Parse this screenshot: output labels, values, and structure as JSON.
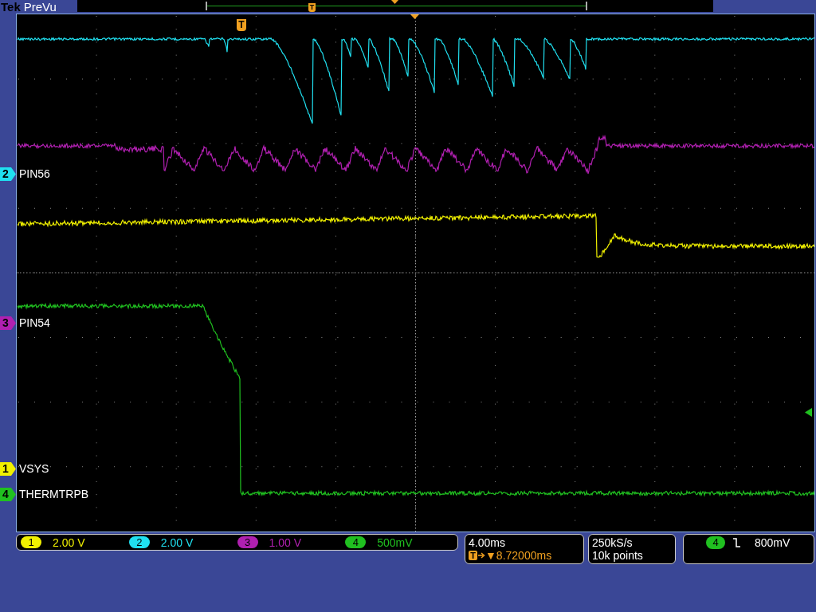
{
  "header": {
    "brand": "Tek",
    "mode": "PreVu",
    "record_marker": "T"
  },
  "graticule": {
    "trigger_marker": "T"
  },
  "channel_labels": [
    {
      "number": "2",
      "label": "PIN56",
      "color": "#20e0f0"
    },
    {
      "number": "3",
      "label": "PIN54",
      "color": "#b020b0"
    },
    {
      "number": "1",
      "label": "VSYS",
      "color": "#f0f000"
    },
    {
      "number": "4",
      "label": "THERMTRPB",
      "color": "#20c020"
    }
  ],
  "channel_scales": [
    {
      "number": "1",
      "scale": "2.00 V",
      "color": "#f0f000"
    },
    {
      "number": "2",
      "scale": "2.00 V",
      "color": "#20e0f0"
    },
    {
      "number": "3",
      "scale": "1.00 V",
      "color": "#b020b0"
    },
    {
      "number": "4",
      "scale": "500mV",
      "color": "#20c020"
    }
  ],
  "timebase": {
    "scale": "4.00ms",
    "trigger_badge": "T",
    "delay": "▼8.72000ms"
  },
  "acquisition": {
    "rate": "250kS/s",
    "points": "10k points"
  },
  "trigger": {
    "channel": "4",
    "level": "800mV",
    "color": "#20c020"
  }
}
